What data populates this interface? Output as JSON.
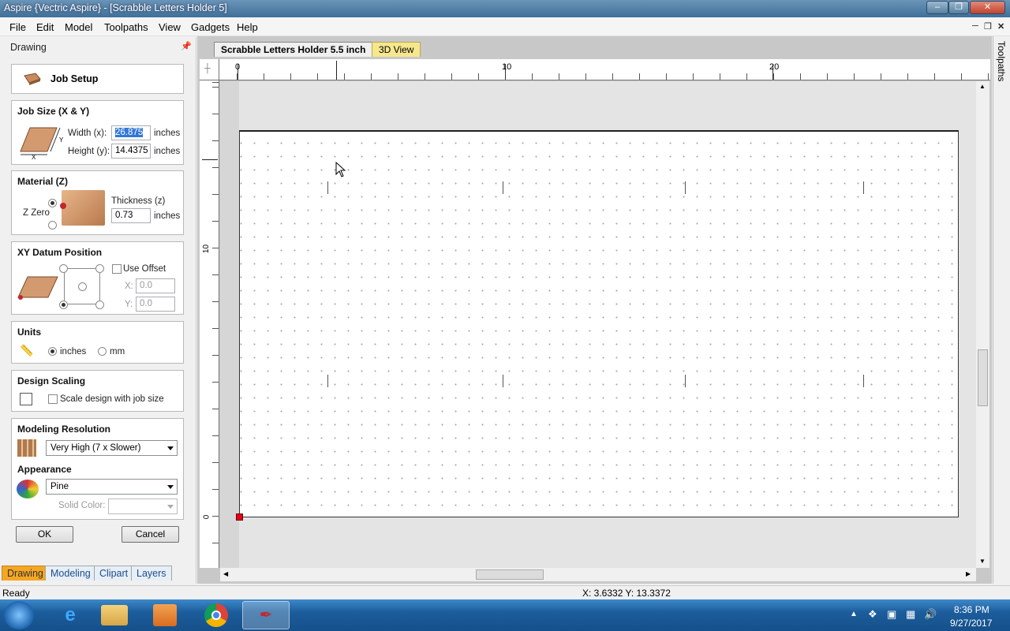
{
  "window": {
    "title": "Aspire {Vectric Aspire} - [Scrabble Letters Holder 5]"
  },
  "menu": [
    "File",
    "Edit",
    "Model",
    "Toolpaths",
    "View",
    "Gadgets",
    "Help"
  ],
  "panel": {
    "header": "Drawing",
    "job_setup": "Job Setup",
    "job_size": {
      "title": "Job Size (X & Y)",
      "width_label": "Width (x):",
      "width_value": "26.875",
      "width_unit": "inches",
      "height_label": "Height (y):",
      "height_value": "14.4375",
      "height_unit": "inches",
      "x_letter": "X",
      "y_letter": "Y"
    },
    "material": {
      "title": "Material (Z)",
      "z_zero_label": "Z Zero",
      "thickness_label": "Thickness (z)",
      "thickness_value": "0.73",
      "thickness_unit": "inches"
    },
    "datum": {
      "title": "XY Datum Position",
      "use_offset_label": "Use Offset",
      "x_label": "X:",
      "x_value": "0.0",
      "y_label": "Y:",
      "y_value": "0.0"
    },
    "units": {
      "title": "Units",
      "inches_label": "inches",
      "mm_label": "mm",
      "selected": "inches"
    },
    "scaling": {
      "title": "Design Scaling",
      "checkbox_label": "Scale design with job size"
    },
    "resolution": {
      "title": "Modeling Resolution",
      "value": "Very High (7 x Slower)"
    },
    "appearance": {
      "title": "Appearance",
      "value": "Pine",
      "solid_color_label": "Solid Color:"
    },
    "ok_label": "OK",
    "cancel_label": "Cancel"
  },
  "bottom_tabs": [
    "Drawing",
    "Modeling",
    "Clipart",
    "Layers"
  ],
  "doc_tabs": [
    "Scrabble Letters Holder 5.5 inch",
    "3D View"
  ],
  "ruler": {
    "h_labels": [
      "0",
      "10",
      "20"
    ],
    "v_labels": [
      "10",
      "0"
    ]
  },
  "side_tab": "Toolpaths",
  "status": {
    "left": "Ready",
    "coords": "X: 3.6332 Y: 13.3372"
  },
  "taskbar": {
    "time": "8:36 PM",
    "date": "9/27/2017"
  },
  "colors": {
    "origin_marker": "#e0001b",
    "taskbar": "#1c5d9c",
    "tab_active": "#f5a623"
  }
}
